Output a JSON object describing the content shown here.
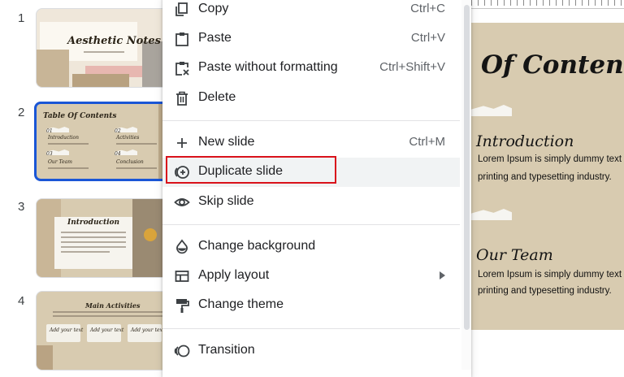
{
  "filmstrip": {
    "slides": [
      {
        "number": "1",
        "title": "Aesthetic Notes"
      },
      {
        "number": "2",
        "title": "Table Of Contents",
        "items": [
          "Introduction",
          "Activities",
          "Our Team",
          "Conclusion"
        ],
        "tags": [
          "01",
          "02",
          "03",
          "04"
        ]
      },
      {
        "number": "3",
        "title": "Introduction"
      },
      {
        "number": "4",
        "title": "Main Activities",
        "cards": [
          "Add your text",
          "Add your text",
          "Add your text"
        ]
      }
    ]
  },
  "menu": {
    "items": [
      {
        "label": "Copy",
        "shortcut": "Ctrl+C",
        "icon": "copy-icon"
      },
      {
        "label": "Paste",
        "shortcut": "Ctrl+V",
        "icon": "paste-icon"
      },
      {
        "label": "Paste without formatting",
        "shortcut": "Ctrl+Shift+V",
        "icon": "paste-plain-icon"
      },
      {
        "label": "Delete",
        "shortcut": "",
        "icon": "trash-icon"
      },
      {
        "label": "New slide",
        "shortcut": "Ctrl+M",
        "icon": "plus-icon"
      },
      {
        "label": "Duplicate slide",
        "shortcut": "",
        "icon": "duplicate-icon"
      },
      {
        "label": "Skip slide",
        "shortcut": "",
        "icon": "eye-icon"
      },
      {
        "label": "Change background",
        "shortcut": "",
        "icon": "droplet-icon"
      },
      {
        "label": "Apply layout",
        "shortcut": "",
        "icon": "layout-icon"
      },
      {
        "label": "Change theme",
        "shortcut": "",
        "icon": "paint-roller-icon"
      },
      {
        "label": "Transition",
        "shortcut": "",
        "icon": "transition-icon"
      }
    ],
    "highlight_color": "#d9121b"
  },
  "canvas": {
    "title": "Of Contents",
    "sections": [
      {
        "heading": "Introduction",
        "lines": [
          "Lorem Ipsum is simply dummy text of",
          "printing and typesetting industry."
        ]
      },
      {
        "heading": "Our Team",
        "lines": [
          "Lorem Ipsum is simply dummy text of",
          "printing and typesetting industry."
        ]
      }
    ]
  },
  "colors": {
    "selection": "#1a56d6",
    "slide_bg": "#d8cbb0"
  }
}
